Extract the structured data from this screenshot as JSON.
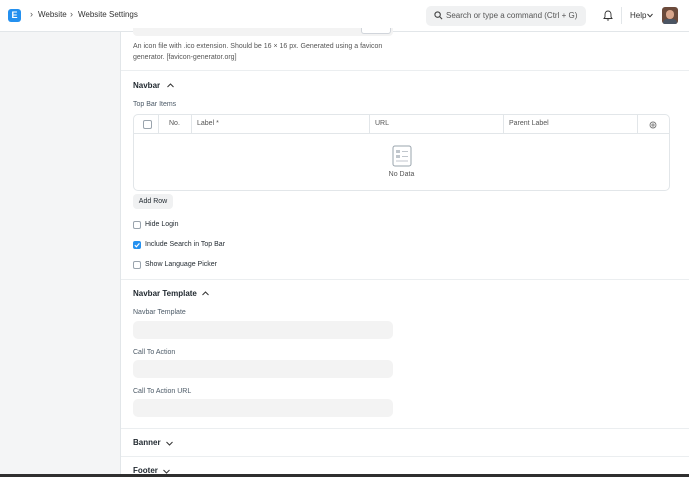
{
  "breadcrumbs": [
    "Website",
    "Website Settings"
  ],
  "logo_letter": "E",
  "search": {
    "placeholder": "Search or type a command (Ctrl + G)"
  },
  "help": {
    "label": "Help"
  },
  "favicon_description": "An icon file with .ico extension. Should be 16 × 16 px. Generated using a favicon generator. [favicon-generator.org]",
  "navbar_section": {
    "title": "Navbar",
    "top_bar_items_label": "Top Bar Items",
    "table": {
      "columns": [
        "No.",
        "Label *",
        "URL",
        "Parent Label"
      ],
      "empty_text": "No Data"
    },
    "add_row_label": "Add Row",
    "checkboxes": [
      {
        "label": "Hide Login",
        "checked": false
      },
      {
        "label": "Include Search in Top Bar",
        "checked": true
      },
      {
        "label": "Show Language Picker",
        "checked": false
      }
    ]
  },
  "navbar_template_section": {
    "title": "Navbar Template",
    "fields": [
      {
        "label": "Navbar Template",
        "value": ""
      },
      {
        "label": "Call To Action",
        "value": ""
      },
      {
        "label": "Call To Action URL",
        "value": ""
      }
    ]
  },
  "collapsed_sections": [
    "Banner",
    "Footer"
  ],
  "colors": {
    "accent": "#2490ef",
    "background": "#f4f5f6",
    "field_bg": "#f3f3f3"
  }
}
